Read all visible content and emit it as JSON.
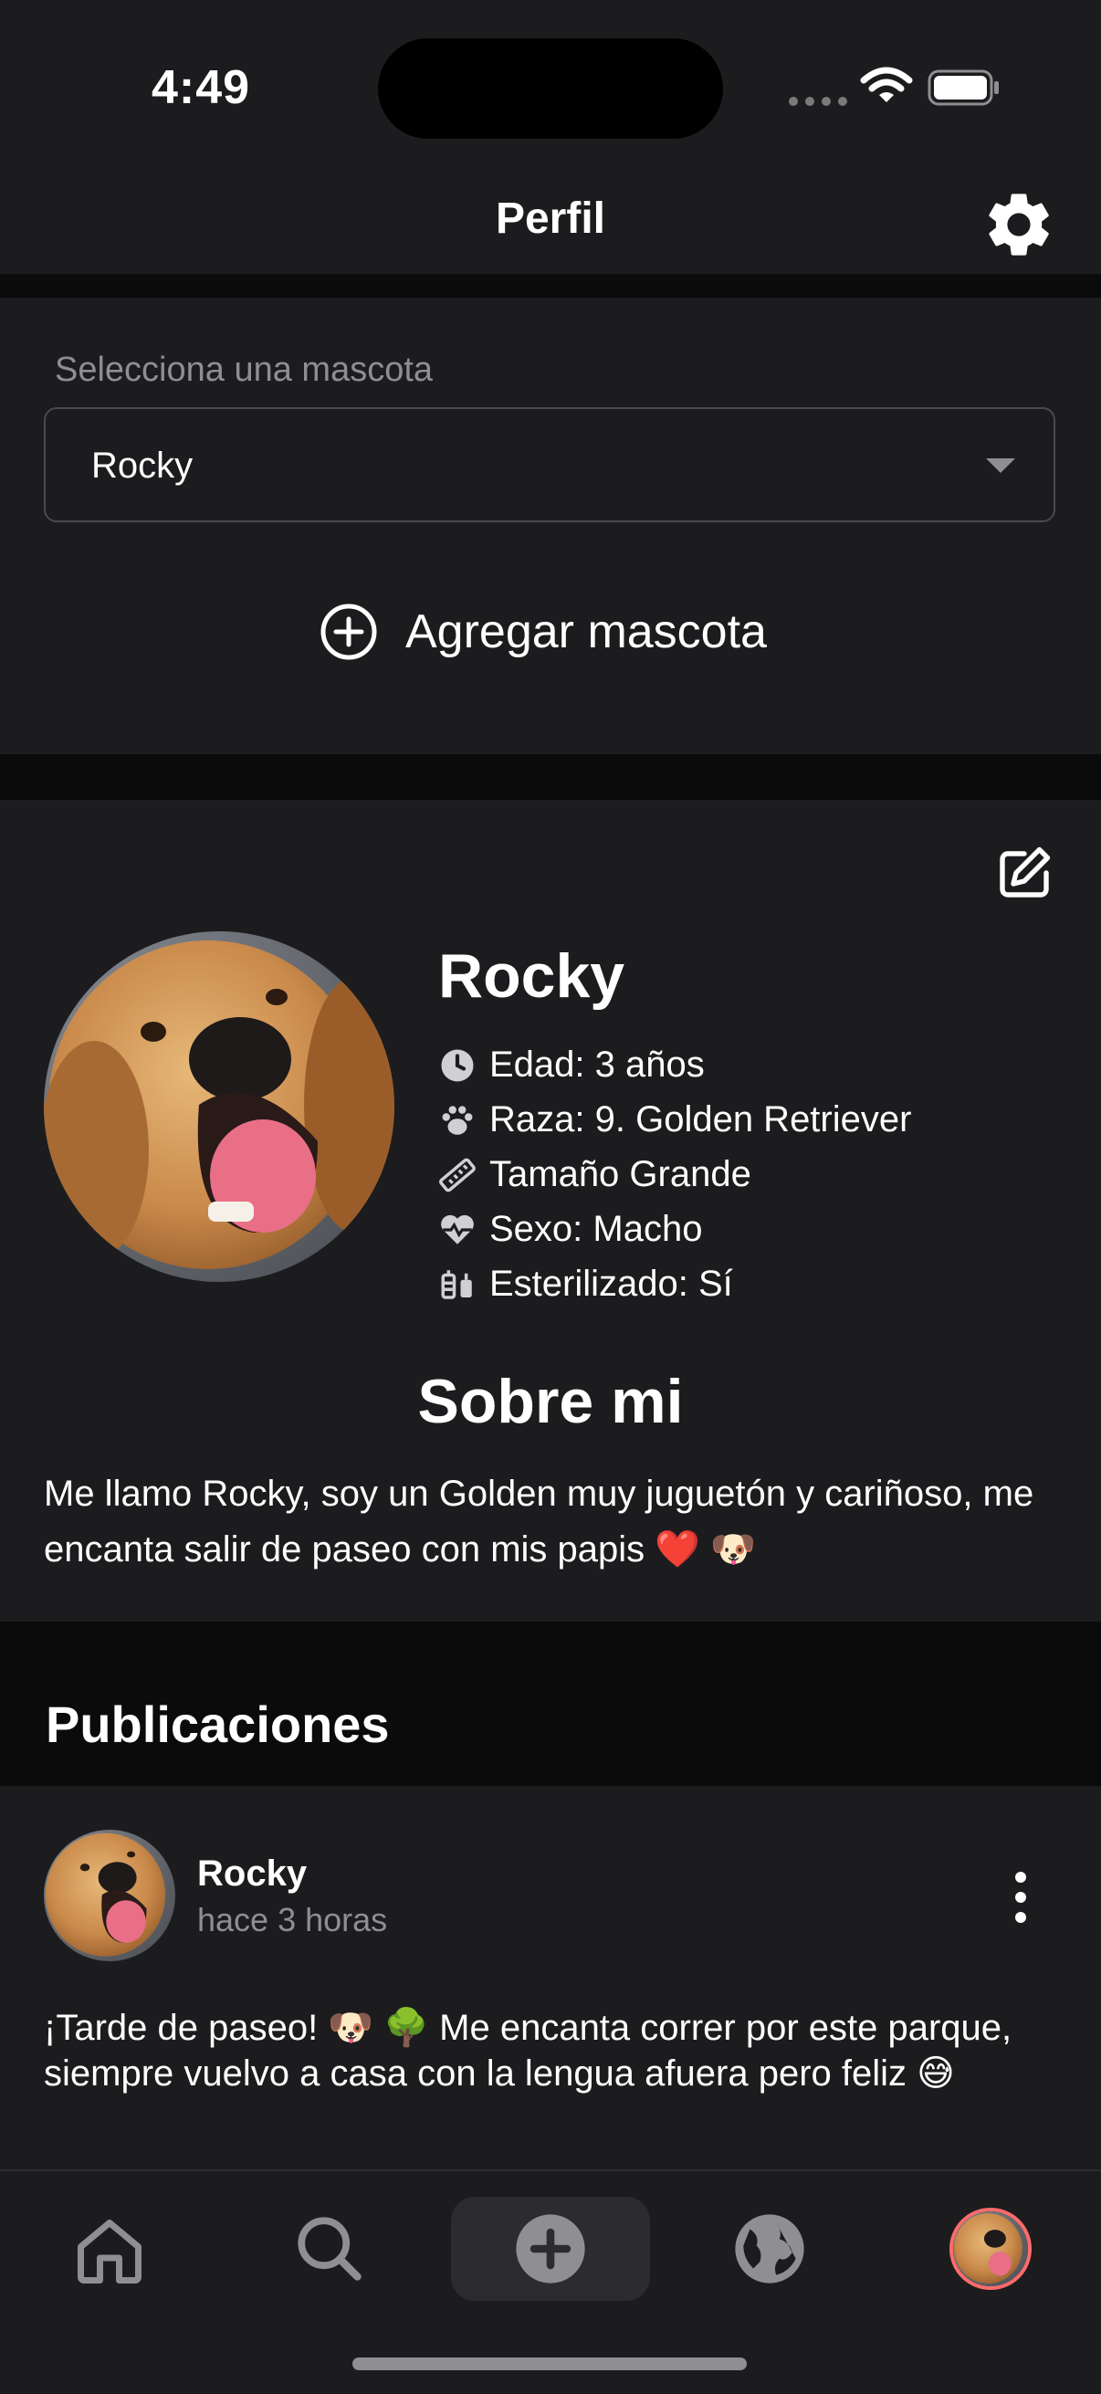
{
  "status_bar": {
    "time": "4:49"
  },
  "header": {
    "title": "Perfil",
    "settings_icon": "gear-icon"
  },
  "pet_selector": {
    "label": "Selecciona una mascota",
    "selected": "Rocky",
    "add_label": "Agregar mascota"
  },
  "profile": {
    "name": "Rocky",
    "info": [
      {
        "icon": "clock-icon",
        "text": "Edad: 3 años"
      },
      {
        "icon": "paw-icon",
        "text": "Raza: 9. Golden Retriever"
      },
      {
        "icon": "ruler-icon",
        "text": "Tamaño Grande"
      },
      {
        "icon": "heartbeat-icon",
        "text": "Sexo: Macho"
      },
      {
        "icon": "syringe-icon",
        "text": "Esterilizado: Sí"
      }
    ],
    "about_title": "Sobre mi",
    "about_text": "Me llamo Rocky, soy un Golden muy juguetón y cariñoso, me encanta salir de paseo con mis papis ❤️ 🐶"
  },
  "posts": {
    "title": "Publicaciones",
    "items": [
      {
        "author": "Rocky",
        "time": "hace 3 horas",
        "text": "¡Tarde de paseo! 🐶 🌳 Me encanta correr por este parque, siempre vuelvo a casa con la lengua afuera pero feliz 😅"
      }
    ]
  },
  "tab_bar": {
    "tabs": [
      "home-icon",
      "search-icon",
      "add-icon",
      "globe-icon",
      "profile-avatar"
    ]
  },
  "colors": {
    "background": "#1c1c1e",
    "accent_ring": "#ff6b6b",
    "muted_text": "#8e8e93"
  }
}
